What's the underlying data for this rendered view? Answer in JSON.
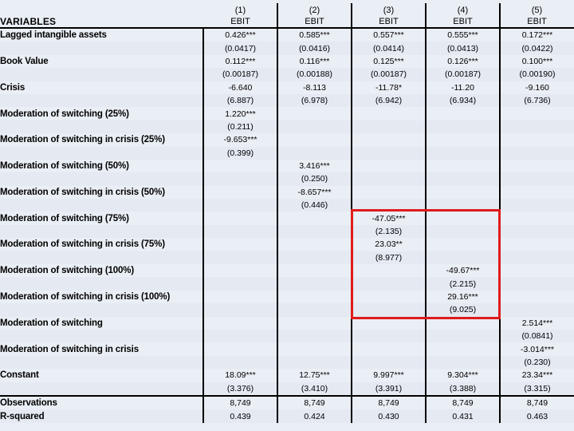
{
  "table": {
    "header": {
      "label": "VARIABLES",
      "columns": [
        {
          "number": "(1)",
          "dependent": "EBIT"
        },
        {
          "number": "(2)",
          "dependent": "EBIT"
        },
        {
          "number": "(3)",
          "dependent": "EBIT"
        },
        {
          "number": "(4)",
          "dependent": "EBIT"
        },
        {
          "number": "(5)",
          "dependent": "EBIT"
        }
      ]
    },
    "rows": [
      {
        "label": "Lagged intangible assets",
        "coef": [
          "0.426***",
          "0.585***",
          "0.557***",
          "0.555***",
          "0.172***"
        ],
        "se": [
          "(0.0417)",
          "(0.0416)",
          "(0.0414)",
          "(0.0413)",
          "(0.0422)"
        ]
      },
      {
        "label": "Book Value",
        "coef": [
          "0.112***",
          "0.116***",
          "0.125***",
          "0.126***",
          "0.100***"
        ],
        "se": [
          "(0.00187)",
          "(0.00188)",
          "(0.00187)",
          "(0.00187)",
          "(0.00190)"
        ]
      },
      {
        "label": "Crisis",
        "coef": [
          "-6.640",
          "-8.113",
          "-11.78*",
          "-11.20",
          "-9.160"
        ],
        "se": [
          "(6.887)",
          "(6.978)",
          "(6.942)",
          "(6.934)",
          "(6.736)"
        ]
      },
      {
        "label": "Moderation of switching (25%)",
        "coef": [
          "1.220***",
          "",
          "",
          "",
          ""
        ],
        "se": [
          "(0.211)",
          "",
          "",
          "",
          ""
        ]
      },
      {
        "label": "Moderation of switching in crisis (25%)",
        "coef": [
          "-9.653***",
          "",
          "",
          "",
          ""
        ],
        "se": [
          "(0.399)",
          "",
          "",
          "",
          ""
        ]
      },
      {
        "label": "Moderation of switching (50%)",
        "coef": [
          "",
          "3.416***",
          "",
          "",
          ""
        ],
        "se": [
          "",
          "(0.250)",
          "",
          "",
          ""
        ]
      },
      {
        "label": "Moderation of switching in crisis (50%)",
        "coef": [
          "",
          "-8.657***",
          "",
          "",
          ""
        ],
        "se": [
          "",
          "(0.446)",
          "",
          "",
          ""
        ]
      },
      {
        "label": "Moderation of switching (75%)",
        "coef": [
          "",
          "",
          "-47.05***",
          "",
          ""
        ],
        "se": [
          "",
          "",
          "(2.135)",
          "",
          ""
        ]
      },
      {
        "label": "Moderation of switching in crisis (75%)",
        "coef": [
          "",
          "",
          "23.03**",
          "",
          ""
        ],
        "se": [
          "",
          "",
          "(8.977)",
          "",
          ""
        ]
      },
      {
        "label": "Moderation of switching (100%)",
        "coef": [
          "",
          "",
          "",
          "-49.67***",
          ""
        ],
        "se": [
          "",
          "",
          "",
          "(2.215)",
          ""
        ]
      },
      {
        "label": "Moderation of switching in crisis (100%)",
        "coef": [
          "",
          "",
          "",
          "29.16***",
          ""
        ],
        "se": [
          "",
          "",
          "",
          "(9.025)",
          ""
        ]
      },
      {
        "label": "Moderation of switching",
        "coef": [
          "",
          "",
          "",
          "",
          "2.514***"
        ],
        "se": [
          "",
          "",
          "",
          "",
          "(0.0841)"
        ]
      },
      {
        "label": "Moderation of switching in crisis",
        "coef": [
          "",
          "",
          "",
          "",
          "-3.014***"
        ],
        "se": [
          "",
          "",
          "",
          "",
          "(0.230)"
        ]
      },
      {
        "label": "Constant",
        "coef": [
          "18.09***",
          "12.75***",
          "9.997***",
          "9.304***",
          "23.34***"
        ],
        "se": [
          "(3.376)",
          "(3.410)",
          "(3.391)",
          "(3.388)",
          "(3.315)"
        ]
      }
    ],
    "stats": [
      {
        "label": "Observations",
        "values": [
          "8,749",
          "8,749",
          "8,749",
          "8,749",
          "8,749"
        ]
      },
      {
        "label": "R-squared",
        "values": [
          "0.439",
          "0.424",
          "0.430",
          "0.431",
          "0.463"
        ]
      }
    ],
    "annotation": {
      "name": "red-highlight-box",
      "color": "#e01b1b",
      "spans_columns": [
        "(3)",
        "(4)"
      ]
    },
    "colors": {
      "band_light": "#eaeef5",
      "band_dark": "#e4e9f2",
      "rule": "#000000",
      "highlight": "#e01b1b"
    }
  }
}
